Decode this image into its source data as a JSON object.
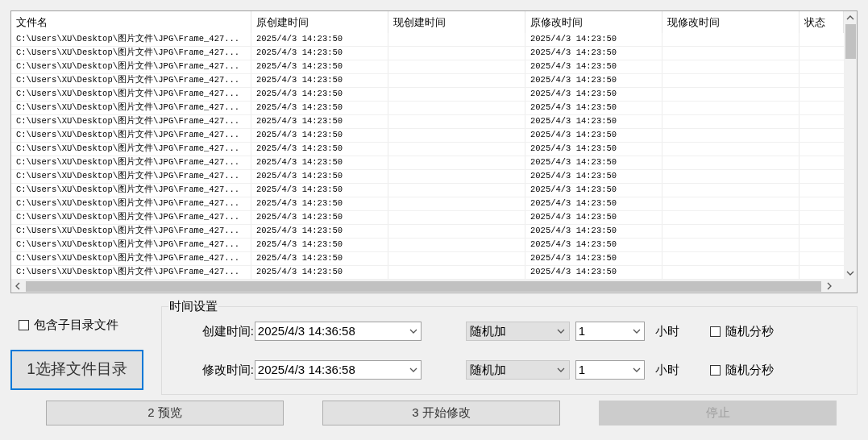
{
  "table": {
    "columns": [
      "文件名",
      "原创建时间",
      "现创建时间",
      "原修改时间",
      "现修改时间",
      "状态"
    ],
    "rows": [
      {
        "file": "C:\\Users\\XU\\Desktop\\图片文件\\JPG\\Frame_427...",
        "orig_created": "2025/4/3 14:23:50",
        "orig_modified": "2025/4/3 14:23:50"
      },
      {
        "file": "C:\\Users\\XU\\Desktop\\图片文件\\JPG\\Frame_427...",
        "orig_created": "2025/4/3 14:23:50",
        "orig_modified": "2025/4/3 14:23:50"
      },
      {
        "file": "C:\\Users\\XU\\Desktop\\图片文件\\JPG\\Frame_427...",
        "orig_created": "2025/4/3 14:23:50",
        "orig_modified": "2025/4/3 14:23:50"
      },
      {
        "file": "C:\\Users\\XU\\Desktop\\图片文件\\JPG\\Frame_427...",
        "orig_created": "2025/4/3 14:23:50",
        "orig_modified": "2025/4/3 14:23:50"
      },
      {
        "file": "C:\\Users\\XU\\Desktop\\图片文件\\JPG\\Frame_427...",
        "orig_created": "2025/4/3 14:23:50",
        "orig_modified": "2025/4/3 14:23:50"
      },
      {
        "file": "C:\\Users\\XU\\Desktop\\图片文件\\JPG\\Frame_427...",
        "orig_created": "2025/4/3 14:23:50",
        "orig_modified": "2025/4/3 14:23:50"
      },
      {
        "file": "C:\\Users\\XU\\Desktop\\图片文件\\JPG\\Frame_427...",
        "orig_created": "2025/4/3 14:23:50",
        "orig_modified": "2025/4/3 14:23:50"
      },
      {
        "file": "C:\\Users\\XU\\Desktop\\图片文件\\JPG\\Frame_427...",
        "orig_created": "2025/4/3 14:23:50",
        "orig_modified": "2025/4/3 14:23:50"
      },
      {
        "file": "C:\\Users\\XU\\Desktop\\图片文件\\JPG\\Frame_427...",
        "orig_created": "2025/4/3 14:23:50",
        "orig_modified": "2025/4/3 14:23:50"
      },
      {
        "file": "C:\\Users\\XU\\Desktop\\图片文件\\JPG\\Frame_427...",
        "orig_created": "2025/4/3 14:23:50",
        "orig_modified": "2025/4/3 14:23:50"
      },
      {
        "file": "C:\\Users\\XU\\Desktop\\图片文件\\JPG\\Frame_427...",
        "orig_created": "2025/4/3 14:23:50",
        "orig_modified": "2025/4/3 14:23:50"
      },
      {
        "file": "C:\\Users\\XU\\Desktop\\图片文件\\JPG\\Frame_427...",
        "orig_created": "2025/4/3 14:23:50",
        "orig_modified": "2025/4/3 14:23:50"
      },
      {
        "file": "C:\\Users\\XU\\Desktop\\图片文件\\JPG\\Frame_427...",
        "orig_created": "2025/4/3 14:23:50",
        "orig_modified": "2025/4/3 14:23:50"
      },
      {
        "file": "C:\\Users\\XU\\Desktop\\图片文件\\JPG\\Frame_427...",
        "orig_created": "2025/4/3 14:23:50",
        "orig_modified": "2025/4/3 14:23:50"
      },
      {
        "file": "C:\\Users\\XU\\Desktop\\图片文件\\JPG\\Frame_427...",
        "orig_created": "2025/4/3 14:23:50",
        "orig_modified": "2025/4/3 14:23:50"
      },
      {
        "file": "C:\\Users\\XU\\Desktop\\图片文件\\JPG\\Frame_427...",
        "orig_created": "2025/4/3 14:23:50",
        "orig_modified": "2025/4/3 14:23:50"
      },
      {
        "file": "C:\\Users\\XU\\Desktop\\图片文件\\JPG\\Frame_427...",
        "orig_created": "2025/4/3 14:23:50",
        "orig_modified": "2025/4/3 14:23:50"
      },
      {
        "file": "C:\\Users\\XU\\Desktop\\图片文件\\JPG\\Frame_427...",
        "orig_created": "2025/4/3 14:23:50",
        "orig_modified": "2025/4/3 14:23:50"
      }
    ]
  },
  "include_subdirs": {
    "label": "包含子目录文件",
    "checked": false
  },
  "choose_dir_button": {
    "label": "1选择文件目录",
    "focused": true
  },
  "time_settings": {
    "title": "时间设置",
    "rows": [
      {
        "label": "创建时间:",
        "datetime": "2025/4/3 14:36:58",
        "mode": "随机加",
        "amount": "1",
        "unit": "小时",
        "random_label": "随机分秒",
        "checked": false
      },
      {
        "label": "修改时间:",
        "datetime": "2025/4/3 14:36:58",
        "mode": "随机加",
        "amount": "1",
        "unit": "小时",
        "random_label": "随机分秒",
        "checked": false
      }
    ]
  },
  "buttons": [
    {
      "label": "2 预览",
      "disabled": false
    },
    {
      "label": "3 开始修改",
      "disabled": false
    },
    {
      "label": "停止",
      "disabled": true
    }
  ]
}
